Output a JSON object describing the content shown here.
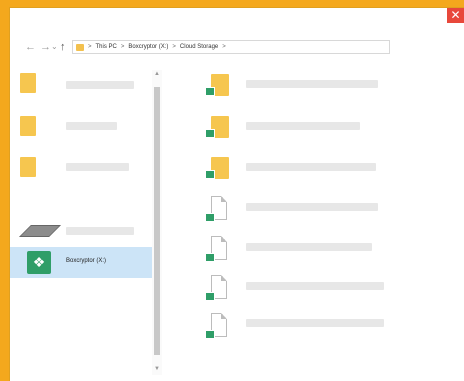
{
  "window": {
    "close_glyph": "✕"
  },
  "nav": {
    "back": "←",
    "forward": "→",
    "down": "⌄",
    "up": "↑"
  },
  "breadcrumb": {
    "sep": ">",
    "items": [
      "This PC",
      "Boxcryptor (X:)",
      "Cloud Storage"
    ],
    "end": ">"
  },
  "sidebar": {
    "selected_label": "Boxcryptor (X:)",
    "selected_icon": "boxcryptor-logo",
    "scroll_up": "▲",
    "scroll_down": "▼"
  },
  "colors": {
    "background": "#f4a81d",
    "folder": "#f6c64f",
    "badge": "#2f9e68",
    "selected": "#cce4f7"
  }
}
